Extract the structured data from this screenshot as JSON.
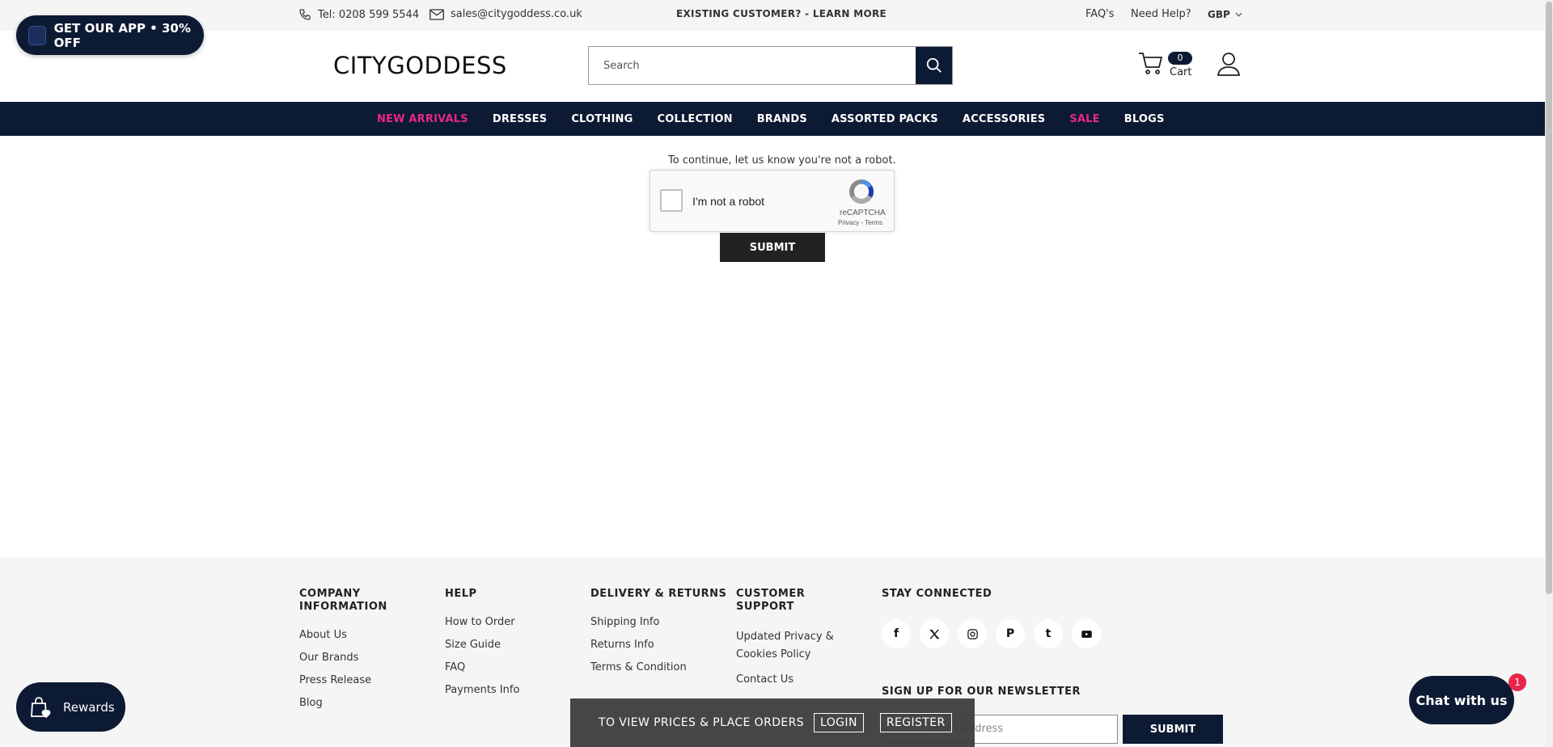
{
  "topbar": {
    "phone": "Tel: 0208 599 5544",
    "email": "sales@citygoddess.co.uk",
    "existing": "EXISTING CUSTOMER? - LEARN MORE",
    "faqs": "FAQ's",
    "help": "Need Help?",
    "currency": "GBP"
  },
  "app_promo": "GET OUR APP • 30% OFF",
  "header": {
    "logo": "CITYGODDESS",
    "search_placeholder": "Search",
    "cart_count": "0",
    "cart_label": "Cart"
  },
  "nav": [
    {
      "label": "NEW ARRIVALS",
      "highlight": true
    },
    {
      "label": "DRESSES",
      "highlight": false
    },
    {
      "label": "CLOTHING",
      "highlight": false
    },
    {
      "label": "COLLECTION",
      "highlight": false
    },
    {
      "label": "BRANDS",
      "highlight": false
    },
    {
      "label": "ASSORTED PACKS",
      "highlight": false
    },
    {
      "label": "ACCESSORIES",
      "highlight": false
    },
    {
      "label": "SALE",
      "highlight": true
    },
    {
      "label": "BLOGS",
      "highlight": false
    }
  ],
  "captcha": {
    "message": "To continue, let us know you're not a robot.",
    "label": "I'm not a robot",
    "brand": "reCAPTCHA",
    "links": "Privacy - Terms",
    "submit": "SUBMIT"
  },
  "footer": {
    "company": {
      "title": "COMPANY INFORMATION",
      "links": [
        "About Us",
        "Our Brands",
        "Press Release",
        "Blog"
      ]
    },
    "help": {
      "title": "HELP",
      "links": [
        "How to Order",
        "Size Guide",
        "FAQ",
        "Payments Info"
      ]
    },
    "delivery": {
      "title": "DELIVERY & RETURNS",
      "links": [
        "Shipping Info",
        "Returns Info",
        "Terms & Condition"
      ]
    },
    "support": {
      "title": "CUSTOMER SUPPORT",
      "links": [
        "Updated Privacy & Cookies Policy",
        "Contact Us"
      ]
    },
    "connected": {
      "title": "STAY CONNECTED",
      "socials": [
        "facebook-icon",
        "twitter-icon",
        "instagram-icon",
        "pinterest-icon",
        "tumblr-icon",
        "youtube-icon"
      ]
    },
    "newsletter": {
      "title": "SIGN UP FOR OUR NEWSLETTER",
      "placeholder": "email address",
      "submit": "SUBMIT"
    }
  },
  "loginbar": {
    "text": "TO VIEW PRICES & PLACE ORDERS",
    "login": "LOGIN",
    "register": "REGISTER"
  },
  "rewards": "Rewards",
  "chat": {
    "label": "Chat with us",
    "badge": "1"
  },
  "colors": {
    "navy": "#0d1a33",
    "pink": "#e8268a"
  }
}
